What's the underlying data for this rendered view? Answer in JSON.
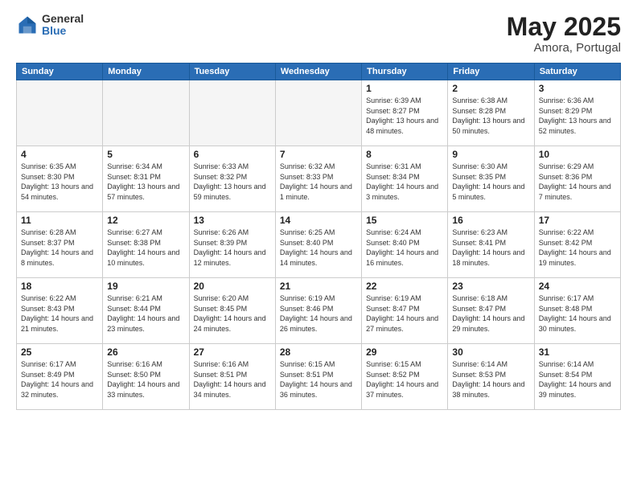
{
  "header": {
    "logo_general": "General",
    "logo_blue": "Blue",
    "title": "May 2025",
    "location": "Amora, Portugal"
  },
  "weekdays": [
    "Sunday",
    "Monday",
    "Tuesday",
    "Wednesday",
    "Thursday",
    "Friday",
    "Saturday"
  ],
  "weeks": [
    [
      {
        "day": "",
        "sunrise": "",
        "sunset": "",
        "daylight": "",
        "empty": true
      },
      {
        "day": "",
        "sunrise": "",
        "sunset": "",
        "daylight": "",
        "empty": true
      },
      {
        "day": "",
        "sunrise": "",
        "sunset": "",
        "daylight": "",
        "empty": true
      },
      {
        "day": "",
        "sunrise": "",
        "sunset": "",
        "daylight": "",
        "empty": true
      },
      {
        "day": "1",
        "sunrise": "Sunrise: 6:39 AM",
        "sunset": "Sunset: 8:27 PM",
        "daylight": "Daylight: 13 hours and 48 minutes.",
        "empty": false
      },
      {
        "day": "2",
        "sunrise": "Sunrise: 6:38 AM",
        "sunset": "Sunset: 8:28 PM",
        "daylight": "Daylight: 13 hours and 50 minutes.",
        "empty": false
      },
      {
        "day": "3",
        "sunrise": "Sunrise: 6:36 AM",
        "sunset": "Sunset: 8:29 PM",
        "daylight": "Daylight: 13 hours and 52 minutes.",
        "empty": false
      }
    ],
    [
      {
        "day": "4",
        "sunrise": "Sunrise: 6:35 AM",
        "sunset": "Sunset: 8:30 PM",
        "daylight": "Daylight: 13 hours and 54 minutes.",
        "empty": false
      },
      {
        "day": "5",
        "sunrise": "Sunrise: 6:34 AM",
        "sunset": "Sunset: 8:31 PM",
        "daylight": "Daylight: 13 hours and 57 minutes.",
        "empty": false
      },
      {
        "day": "6",
        "sunrise": "Sunrise: 6:33 AM",
        "sunset": "Sunset: 8:32 PM",
        "daylight": "Daylight: 13 hours and 59 minutes.",
        "empty": false
      },
      {
        "day": "7",
        "sunrise": "Sunrise: 6:32 AM",
        "sunset": "Sunset: 8:33 PM",
        "daylight": "Daylight: 14 hours and 1 minute.",
        "empty": false
      },
      {
        "day": "8",
        "sunrise": "Sunrise: 6:31 AM",
        "sunset": "Sunset: 8:34 PM",
        "daylight": "Daylight: 14 hours and 3 minutes.",
        "empty": false
      },
      {
        "day": "9",
        "sunrise": "Sunrise: 6:30 AM",
        "sunset": "Sunset: 8:35 PM",
        "daylight": "Daylight: 14 hours and 5 minutes.",
        "empty": false
      },
      {
        "day": "10",
        "sunrise": "Sunrise: 6:29 AM",
        "sunset": "Sunset: 8:36 PM",
        "daylight": "Daylight: 14 hours and 7 minutes.",
        "empty": false
      }
    ],
    [
      {
        "day": "11",
        "sunrise": "Sunrise: 6:28 AM",
        "sunset": "Sunset: 8:37 PM",
        "daylight": "Daylight: 14 hours and 8 minutes.",
        "empty": false
      },
      {
        "day": "12",
        "sunrise": "Sunrise: 6:27 AM",
        "sunset": "Sunset: 8:38 PM",
        "daylight": "Daylight: 14 hours and 10 minutes.",
        "empty": false
      },
      {
        "day": "13",
        "sunrise": "Sunrise: 6:26 AM",
        "sunset": "Sunset: 8:39 PM",
        "daylight": "Daylight: 14 hours and 12 minutes.",
        "empty": false
      },
      {
        "day": "14",
        "sunrise": "Sunrise: 6:25 AM",
        "sunset": "Sunset: 8:40 PM",
        "daylight": "Daylight: 14 hours and 14 minutes.",
        "empty": false
      },
      {
        "day": "15",
        "sunrise": "Sunrise: 6:24 AM",
        "sunset": "Sunset: 8:40 PM",
        "daylight": "Daylight: 14 hours and 16 minutes.",
        "empty": false
      },
      {
        "day": "16",
        "sunrise": "Sunrise: 6:23 AM",
        "sunset": "Sunset: 8:41 PM",
        "daylight": "Daylight: 14 hours and 18 minutes.",
        "empty": false
      },
      {
        "day": "17",
        "sunrise": "Sunrise: 6:22 AM",
        "sunset": "Sunset: 8:42 PM",
        "daylight": "Daylight: 14 hours and 19 minutes.",
        "empty": false
      }
    ],
    [
      {
        "day": "18",
        "sunrise": "Sunrise: 6:22 AM",
        "sunset": "Sunset: 8:43 PM",
        "daylight": "Daylight: 14 hours and 21 minutes.",
        "empty": false
      },
      {
        "day": "19",
        "sunrise": "Sunrise: 6:21 AM",
        "sunset": "Sunset: 8:44 PM",
        "daylight": "Daylight: 14 hours and 23 minutes.",
        "empty": false
      },
      {
        "day": "20",
        "sunrise": "Sunrise: 6:20 AM",
        "sunset": "Sunset: 8:45 PM",
        "daylight": "Daylight: 14 hours and 24 minutes.",
        "empty": false
      },
      {
        "day": "21",
        "sunrise": "Sunrise: 6:19 AM",
        "sunset": "Sunset: 8:46 PM",
        "daylight": "Daylight: 14 hours and 26 minutes.",
        "empty": false
      },
      {
        "day": "22",
        "sunrise": "Sunrise: 6:19 AM",
        "sunset": "Sunset: 8:47 PM",
        "daylight": "Daylight: 14 hours and 27 minutes.",
        "empty": false
      },
      {
        "day": "23",
        "sunrise": "Sunrise: 6:18 AM",
        "sunset": "Sunset: 8:47 PM",
        "daylight": "Daylight: 14 hours and 29 minutes.",
        "empty": false
      },
      {
        "day": "24",
        "sunrise": "Sunrise: 6:17 AM",
        "sunset": "Sunset: 8:48 PM",
        "daylight": "Daylight: 14 hours and 30 minutes.",
        "empty": false
      }
    ],
    [
      {
        "day": "25",
        "sunrise": "Sunrise: 6:17 AM",
        "sunset": "Sunset: 8:49 PM",
        "daylight": "Daylight: 14 hours and 32 minutes.",
        "empty": false
      },
      {
        "day": "26",
        "sunrise": "Sunrise: 6:16 AM",
        "sunset": "Sunset: 8:50 PM",
        "daylight": "Daylight: 14 hours and 33 minutes.",
        "empty": false
      },
      {
        "day": "27",
        "sunrise": "Sunrise: 6:16 AM",
        "sunset": "Sunset: 8:51 PM",
        "daylight": "Daylight: 14 hours and 34 minutes.",
        "empty": false
      },
      {
        "day": "28",
        "sunrise": "Sunrise: 6:15 AM",
        "sunset": "Sunset: 8:51 PM",
        "daylight": "Daylight: 14 hours and 36 minutes.",
        "empty": false
      },
      {
        "day": "29",
        "sunrise": "Sunrise: 6:15 AM",
        "sunset": "Sunset: 8:52 PM",
        "daylight": "Daylight: 14 hours and 37 minutes.",
        "empty": false
      },
      {
        "day": "30",
        "sunrise": "Sunrise: 6:14 AM",
        "sunset": "Sunset: 8:53 PM",
        "daylight": "Daylight: 14 hours and 38 minutes.",
        "empty": false
      },
      {
        "day": "31",
        "sunrise": "Sunrise: 6:14 AM",
        "sunset": "Sunset: 8:54 PM",
        "daylight": "Daylight: 14 hours and 39 minutes.",
        "empty": false
      }
    ]
  ]
}
